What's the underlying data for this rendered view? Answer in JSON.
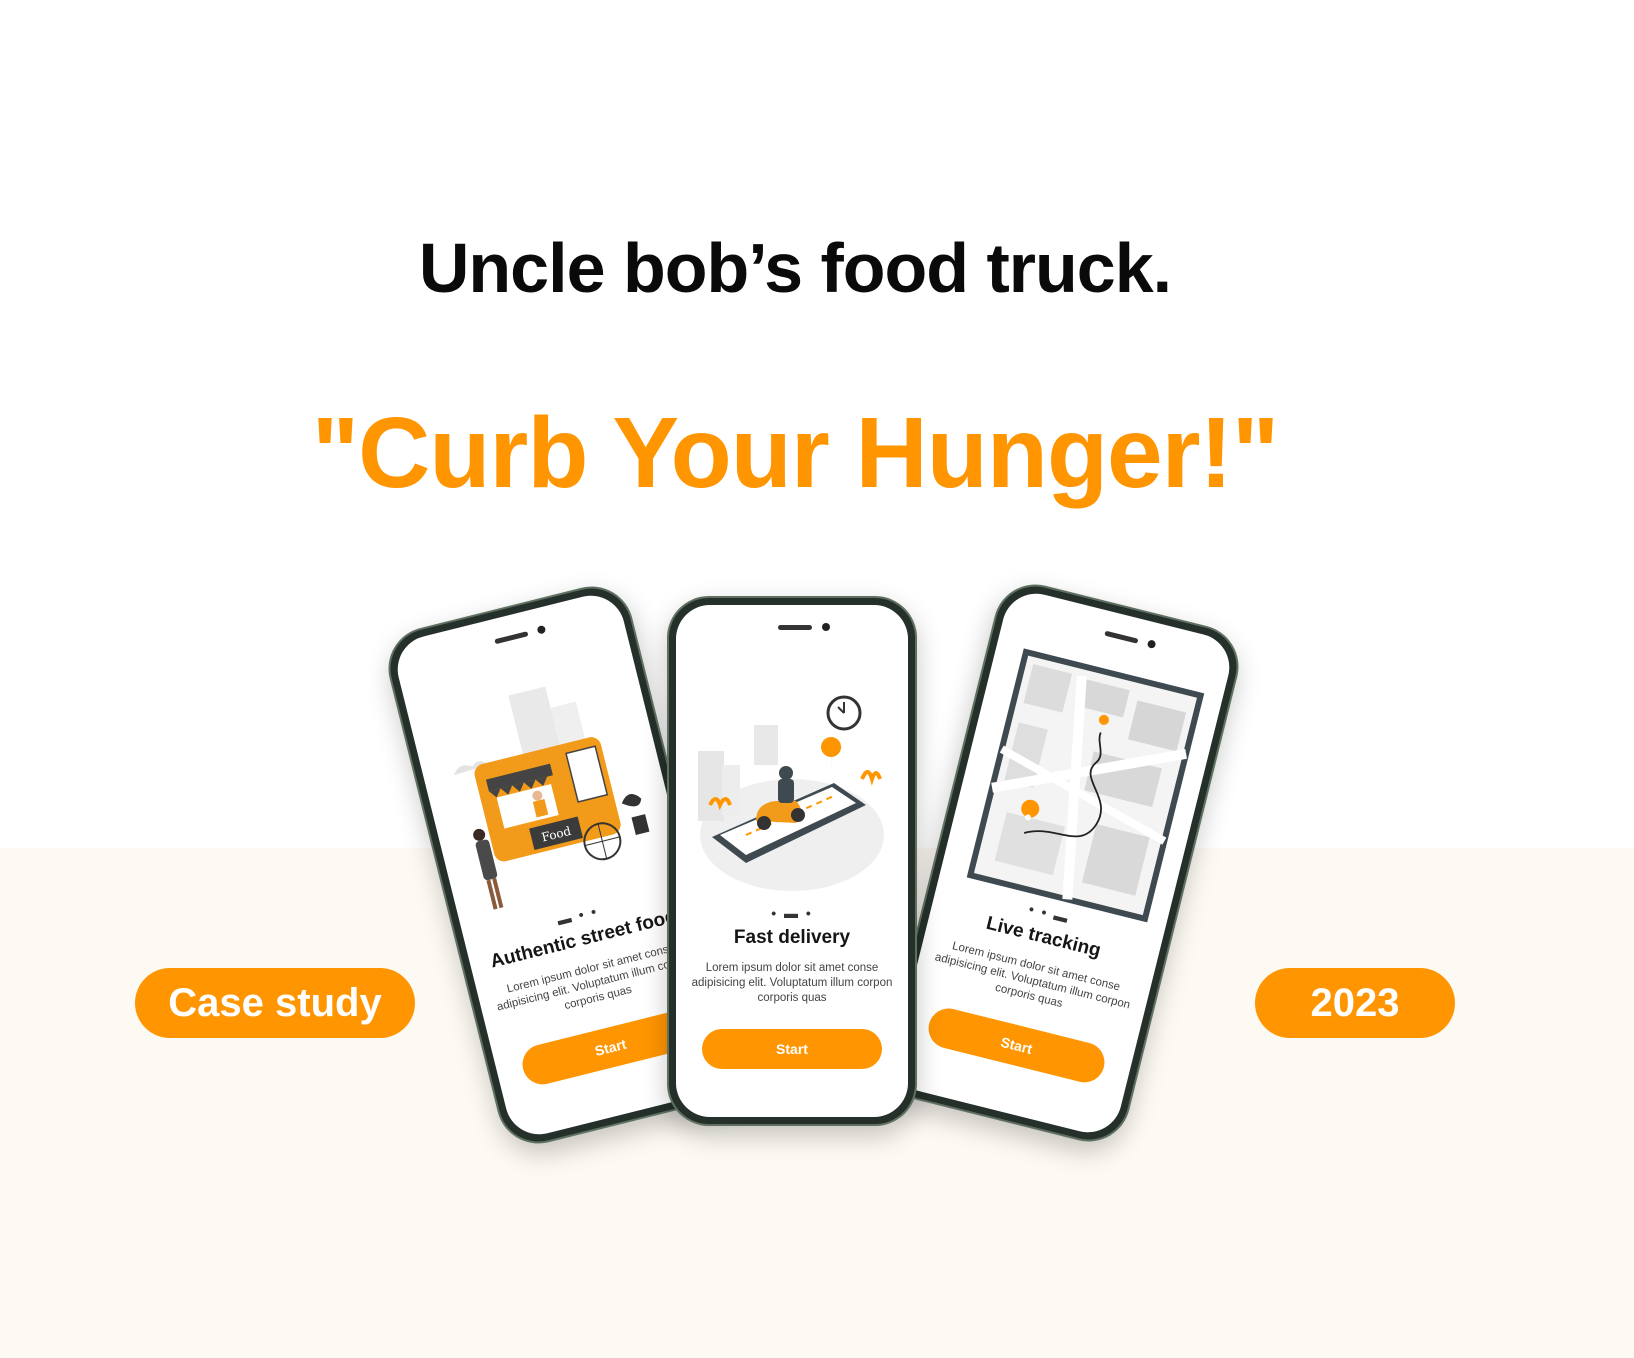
{
  "header": {
    "title": "Uncle bob’s food truck.",
    "tagline": "\"Curb Your Hunger!\""
  },
  "badges": {
    "left": "Case study",
    "right": "2023"
  },
  "phones": [
    {
      "title": "Authentic street food",
      "description": "Lorem ipsum dolor sit amet conse adipisicing elit. Voluptatum illum corpon corporis quas",
      "button": "Start",
      "pager": "▬ • •",
      "truck_sign": "Food"
    },
    {
      "title": "Fast delivery",
      "description": "Lorem ipsum dolor sit amet conse adipisicing elit. Voluptatum illum corpon corporis quas",
      "button": "Start",
      "pager": "• ▬ •"
    },
    {
      "title": "Live tracking",
      "description": "Lorem ipsum dolor sit amet conse adipisicing elit. Voluptatum illum corpon corporis quas",
      "button": "Start",
      "pager": "• • ▬"
    }
  ],
  "colors": {
    "accent": "#ff9500",
    "text": "#0a0a0a",
    "band": "#fdf9f3",
    "phone_frame": "#5f7060"
  }
}
